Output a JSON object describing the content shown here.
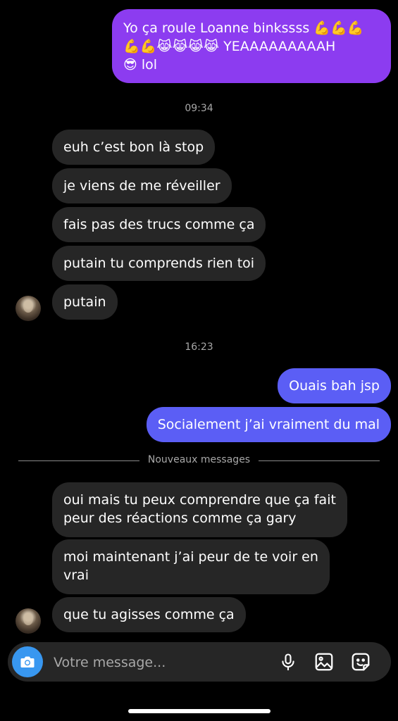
{
  "messages": {
    "m1_line1": "Yo ça roule Loanne binkssss 💪💪💪",
    "m1_line2": "💪💪😹😹😹😹 YEAAAAAAAAAH",
    "m1_line3": "😎 lol",
    "time1": "09:34",
    "m2": "euh c’est bon là stop",
    "m3": "je viens de me réveiller",
    "m4": "fais pas des trucs comme ça",
    "m5": "putain tu comprends rien toi",
    "m6": "putain",
    "time2": "16:23",
    "m7": "Ouais bah jsp",
    "m8": "Socialement j’ai vraiment du mal",
    "m9_line1": "oui mais tu peux comprendre que ça fait",
    "m9_line2": "peur des réactions comme ça gary",
    "m10_line1": "moi maintenant  j’ai peur de te voir en",
    "m10_line2": "vrai",
    "m11": "que tu agisses comme ça"
  },
  "divider": {
    "label": "Nouveaux messages"
  },
  "composer": {
    "placeholder": "Votre message..."
  },
  "colors": {
    "background": "#000000",
    "incoming_bubble": "#262626",
    "outgoing_purple": "#8c3cf0",
    "outgoing_blue": "#5b5ef5",
    "camera_button": "#3897f0"
  },
  "icons": [
    "camera-icon",
    "microphone-icon",
    "gallery-icon",
    "sticker-icon"
  ]
}
